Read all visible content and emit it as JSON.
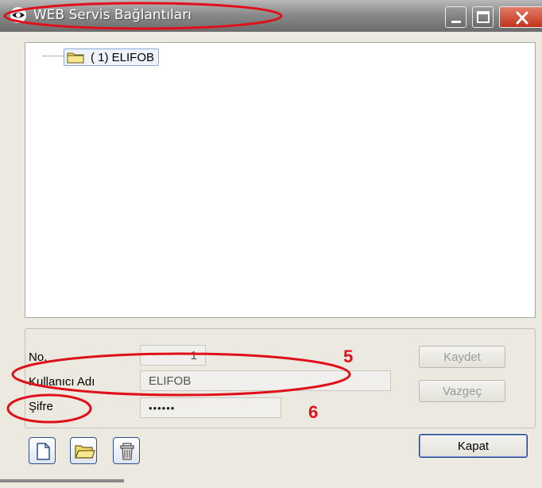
{
  "window": {
    "title": "WEB Servis Bağlantıları",
    "icons": {
      "app": "eye-icon",
      "minimize": "minimize-icon",
      "maximize": "maximize-icon",
      "close": "close-icon"
    }
  },
  "tree": {
    "nodes": [
      {
        "label": "( 1) ELIFOB",
        "icon": "folder-icon"
      }
    ]
  },
  "form": {
    "no_label": "No.",
    "no_value": "1",
    "username_label": "Kullanıcı Adı",
    "username_value": "ELIFOB",
    "password_label": "Şifre",
    "password_value": "••••••"
  },
  "buttons": {
    "save": "Kaydet",
    "cancel": "Vazgeç",
    "close": "Kapat"
  },
  "toolbar": {
    "icons": [
      "new-document-icon",
      "open-folder-icon",
      "delete-icon"
    ]
  },
  "annotations": {
    "marker_5": "5",
    "marker_6": "6",
    "color": "#e0101a"
  },
  "colors": {
    "titlebar": "#8a8a8a",
    "close_button": "#c2331b",
    "panel": "#ece9e1",
    "selection": "#eef3fb"
  }
}
